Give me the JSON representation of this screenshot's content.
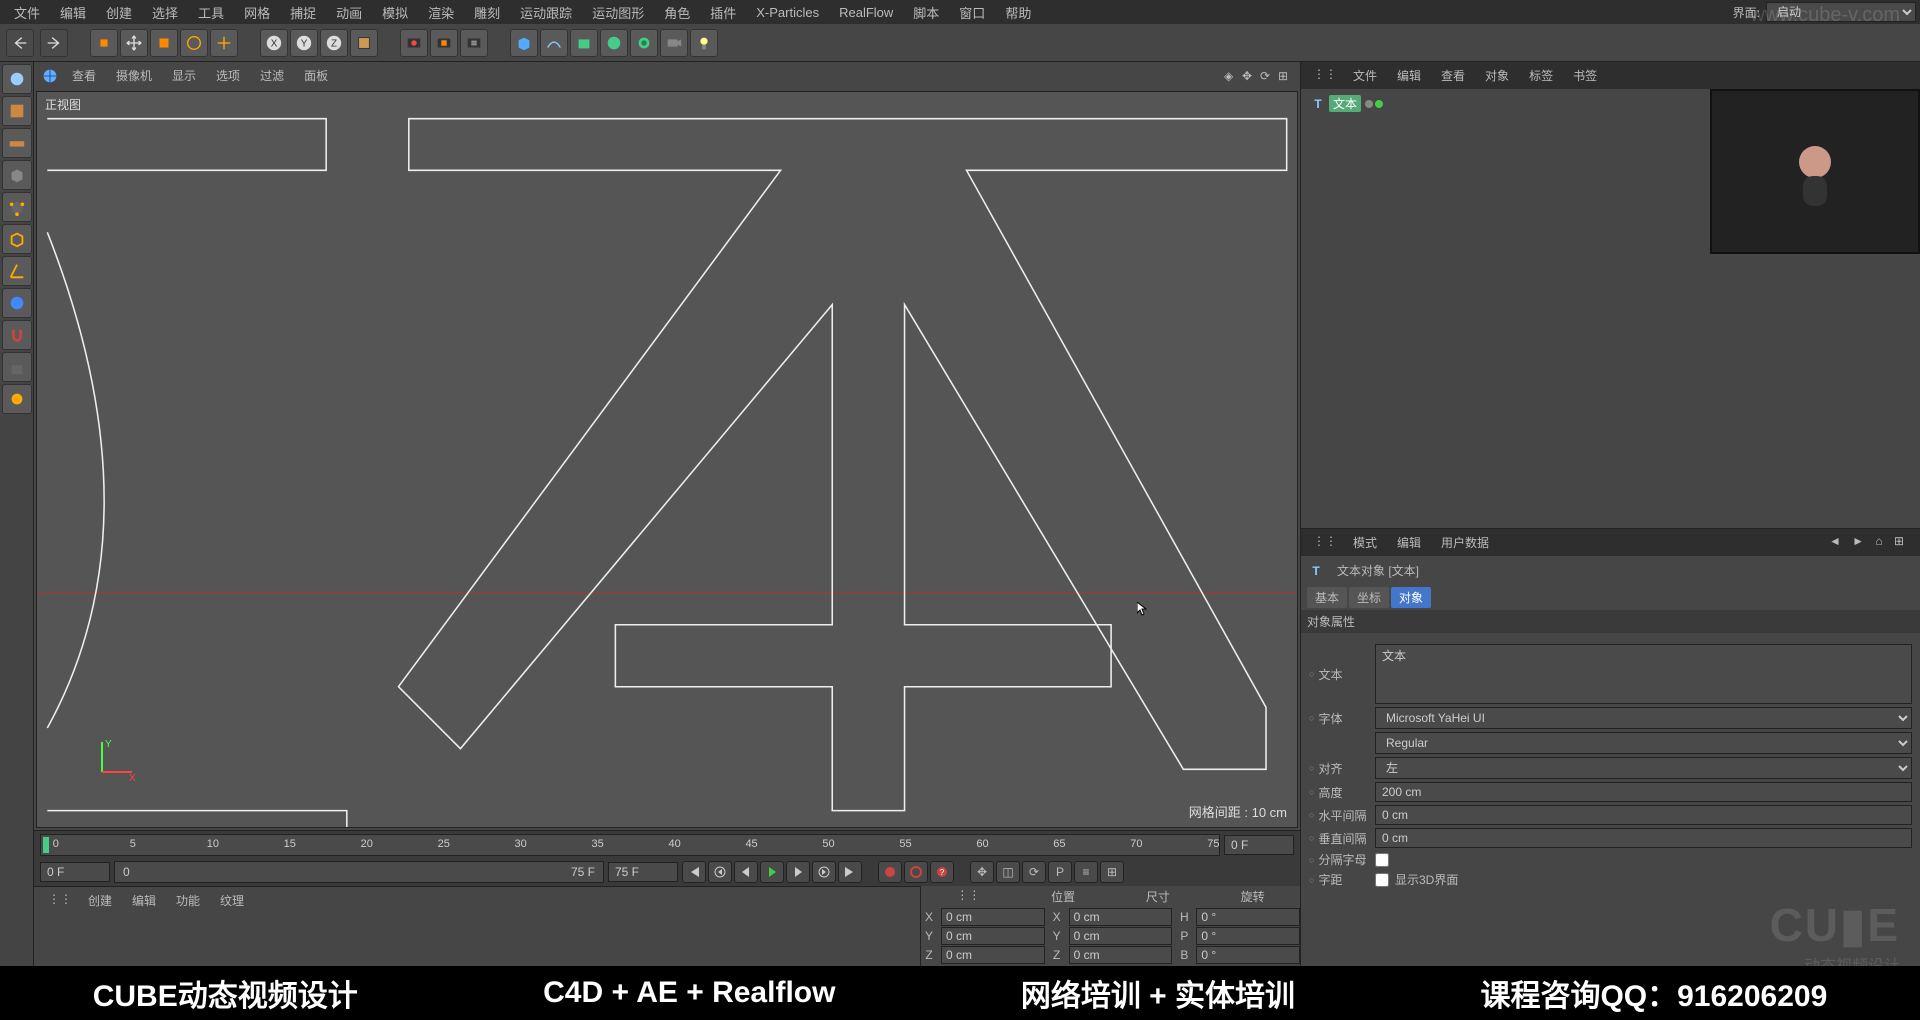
{
  "layout_select": {
    "label": "界面:",
    "value": "启动"
  },
  "menubar": [
    "文件",
    "编辑",
    "创建",
    "选择",
    "工具",
    "网格",
    "捕捉",
    "动画",
    "模拟",
    "渲染",
    "雕刻",
    "运动跟踪",
    "运动图形",
    "角色",
    "插件",
    "X-Particles",
    "RealFlow",
    "脚本",
    "窗口",
    "帮助"
  ],
  "viewport_menu": [
    "查看",
    "摄像机",
    "显示",
    "选项",
    "过滤",
    "面板"
  ],
  "viewport_label": "正视图",
  "grid_info": "网格间距 : 10 cm",
  "timeline": {
    "ticks": [
      "0",
      "5",
      "10",
      "15",
      "20",
      "25",
      "30",
      "35",
      "40",
      "45",
      "50",
      "55",
      "60",
      "65",
      "70",
      "75"
    ],
    "current": "0 F",
    "start": "0 F",
    "range": "0",
    "range_end": "75 F",
    "frame2": "75 F"
  },
  "material_menu": [
    "创建",
    "编辑",
    "功能",
    "纹理"
  ],
  "coord": {
    "headers": [
      "位置",
      "尺寸",
      "旋转"
    ],
    "rows": [
      {
        "a": "X",
        "v1": "0 cm",
        "a2": "X",
        "v2": "0 cm",
        "a3": "H",
        "v3": "0 °"
      },
      {
        "a": "Y",
        "v1": "0 cm",
        "a2": "Y",
        "v2": "0 cm",
        "a3": "P",
        "v3": "0 °"
      },
      {
        "a": "Z",
        "v1": "0 cm",
        "a2": "Z",
        "v2": "0 cm",
        "a3": "B",
        "v3": "0 °"
      }
    ]
  },
  "obj_tabs": [
    "文件",
    "编辑",
    "查看",
    "对象",
    "标签",
    "书签"
  ],
  "obj_tree_item": "文本",
  "attr_tabs_top": [
    "模式",
    "编辑",
    "用户数据"
  ],
  "attr_title": "文本对象 [文本]",
  "attr_tabs": [
    "基本",
    "坐标",
    "对象"
  ],
  "attr_section": "对象属性",
  "attrs": {
    "text_label": "文本",
    "text_value": "文本",
    "font_label": "字体",
    "font_value": "Microsoft YaHei UI",
    "font_style": "Regular",
    "align_label": "对齐",
    "align_value": "左",
    "height_label": "高度",
    "height_value": "200 cm",
    "hspace_label": "水平间隔",
    "hspace_value": "0 cm",
    "vspace_label": "垂直间隔",
    "vspace_value": "0 cm",
    "sep_label": "分隔字母",
    "kern_label": "字距",
    "show3d_label": "显示3D界面"
  },
  "watermark": "www.cube-v.com",
  "cube_logo": {
    "big": "CU▮E",
    "small": "动态视频设计"
  },
  "footer": [
    "CUBE动态视频设计",
    "C4D + AE + Realflow",
    "网络培训 + 实体培训",
    "课程咨询QQ：916206209"
  ]
}
